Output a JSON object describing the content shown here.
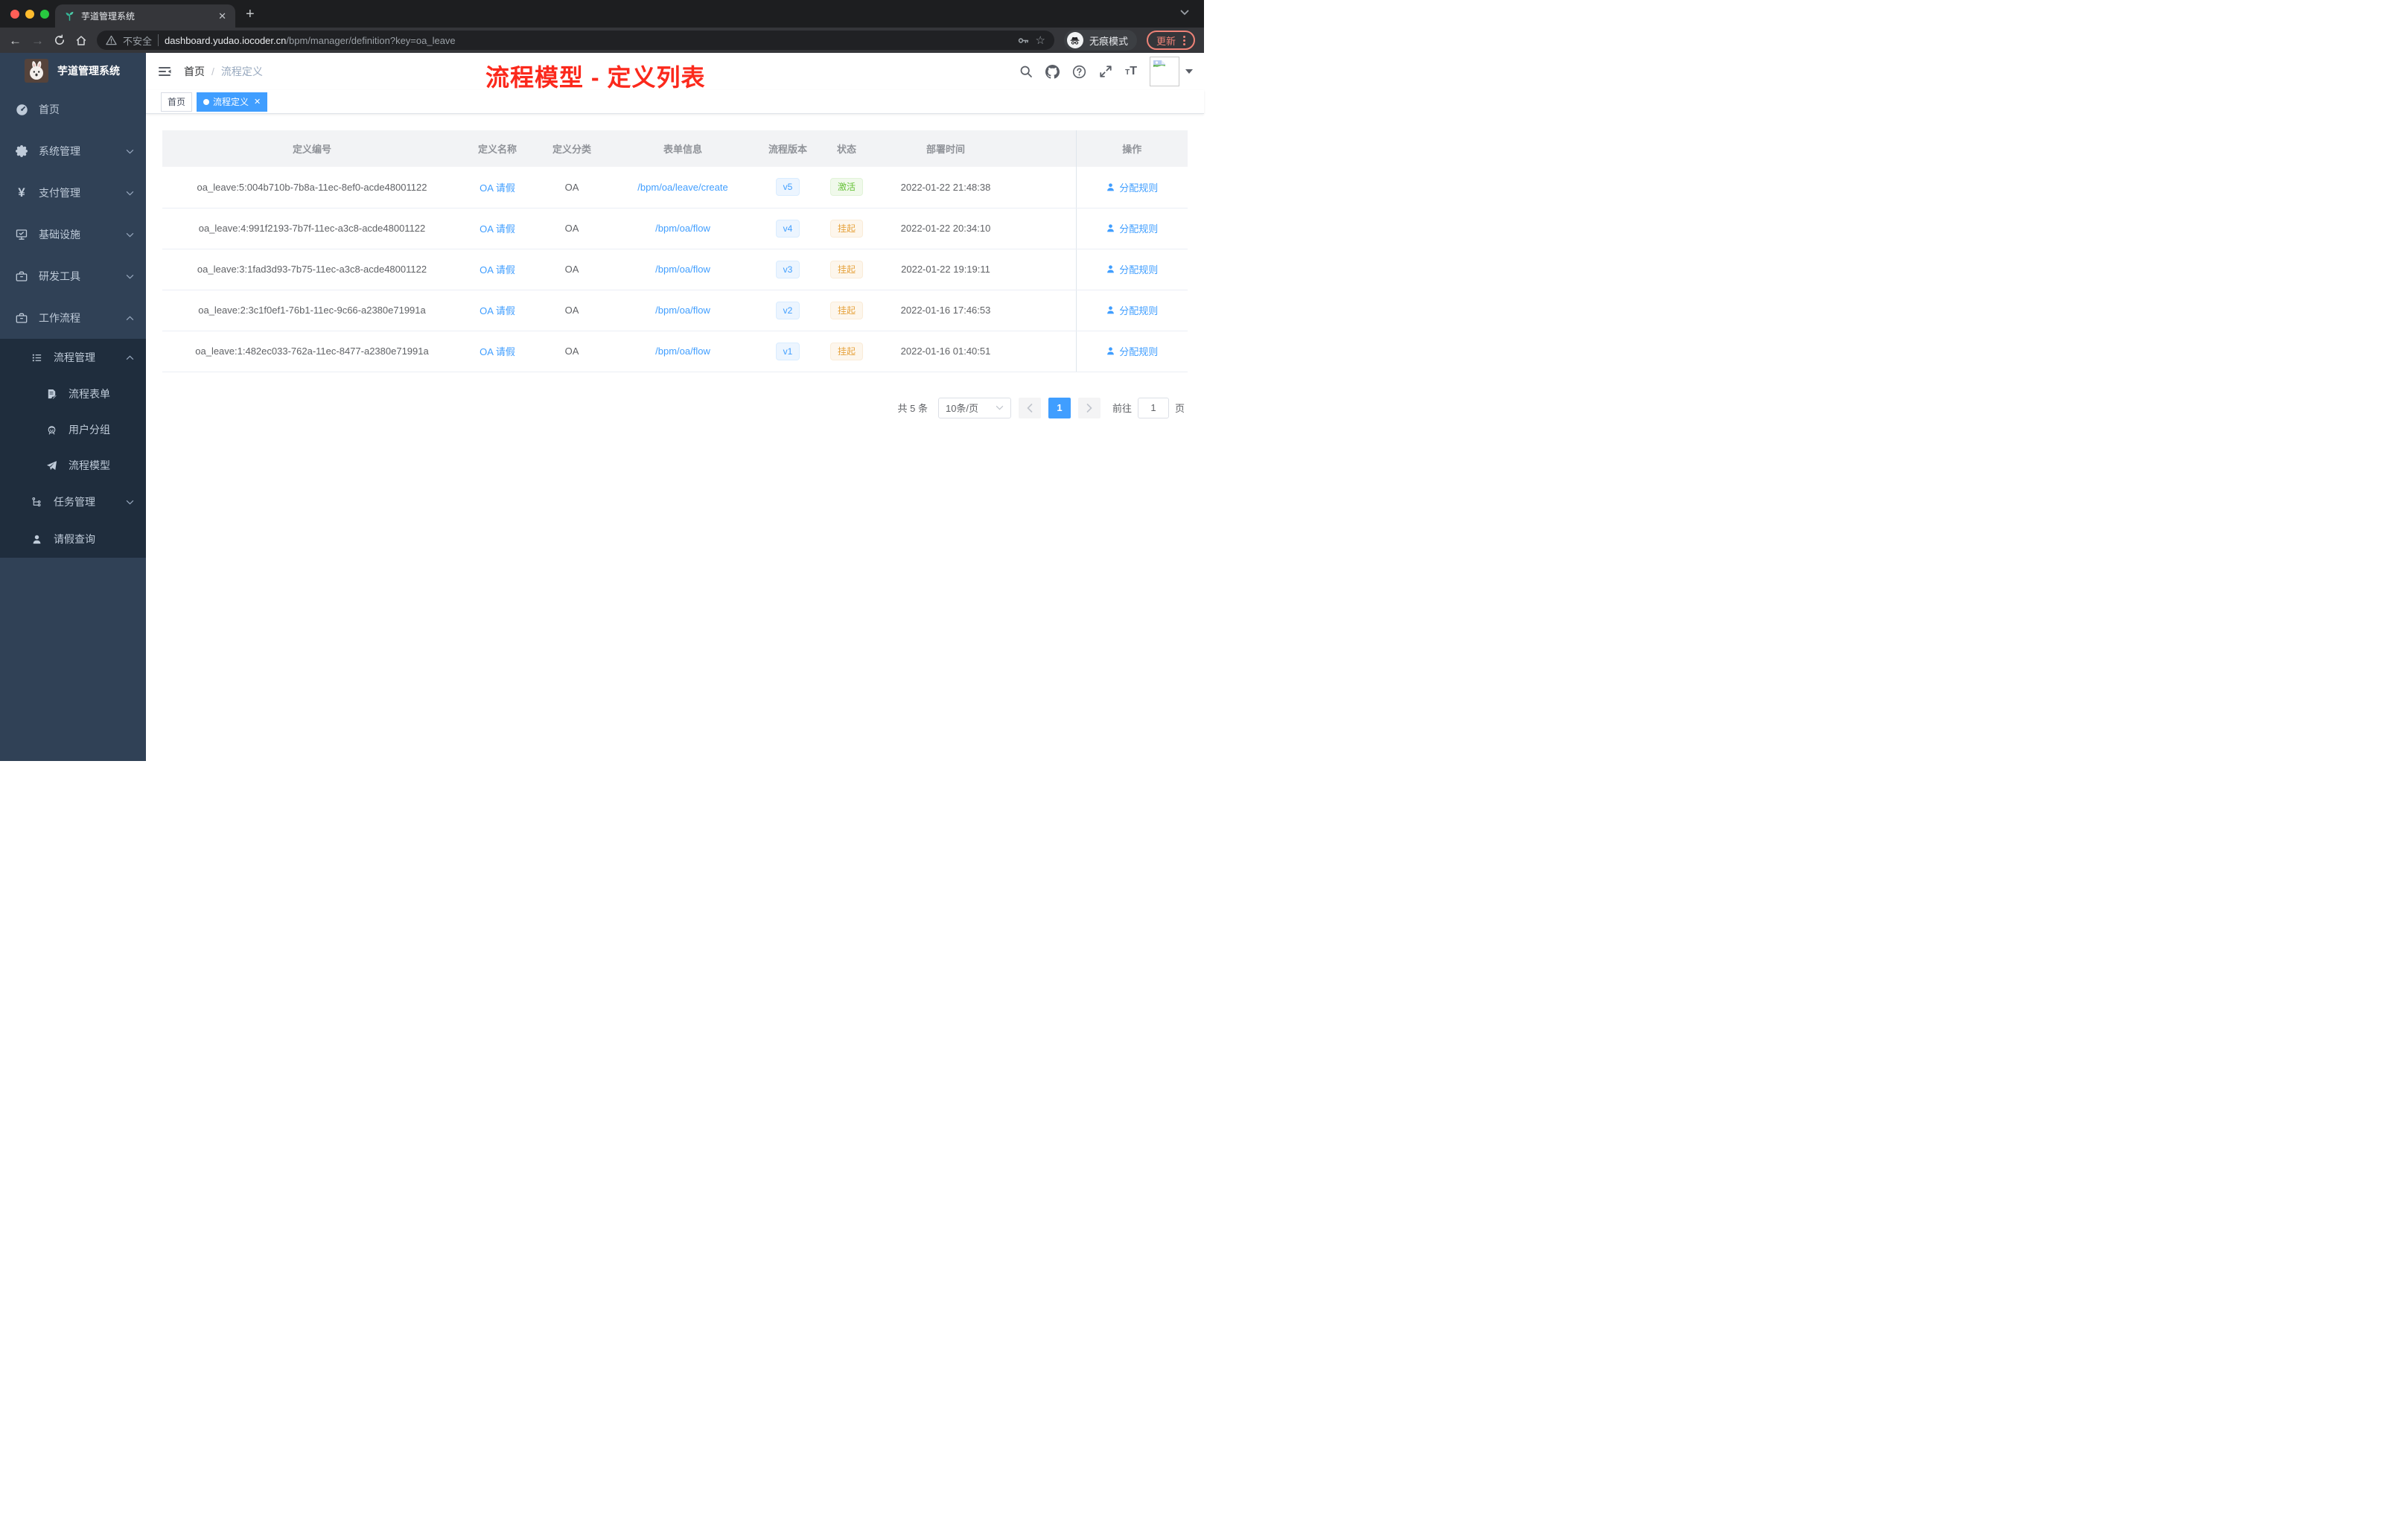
{
  "colors": {
    "accent": "#409eff",
    "sidebar_bg": "#304156",
    "submenu_bg": "#1f2d3d",
    "success": "#67c23a",
    "warning": "#e6a23c",
    "annotation_red": "#fb291c",
    "update_salmon": "#ee8277"
  },
  "browser": {
    "tab_title": "芋道管理系统",
    "security_label": "不安全",
    "url_domain": "dashboard.yudao.iocoder.cn",
    "url_path": "/bpm/manager/definition?key=oa_leave",
    "incognito_label": "无痕模式",
    "update_label": "更新"
  },
  "sidebar": {
    "logo_title": "芋道管理系统",
    "items": [
      {
        "label": "首页"
      },
      {
        "label": "系统管理"
      },
      {
        "label": "支付管理"
      },
      {
        "label": "基础设施"
      },
      {
        "label": "研发工具"
      },
      {
        "label": "工作流程"
      }
    ],
    "workflow_submenu": {
      "process_group": {
        "label": "流程管理",
        "children": [
          {
            "label": "流程表单"
          },
          {
            "label": "用户分组"
          },
          {
            "label": "流程模型"
          }
        ]
      },
      "task_group": {
        "label": "任务管理"
      },
      "leave_item": {
        "label": "请假查询"
      }
    }
  },
  "navbar": {
    "breadcrumb": {
      "home": "首页",
      "separator": "/",
      "current": "流程定义"
    },
    "annotation": "流程模型 - 定义列表"
  },
  "tags": [
    {
      "label": "首页"
    },
    {
      "label": "流程定义"
    }
  ],
  "table": {
    "headers": [
      "定义编号",
      "定义名称",
      "定义分类",
      "表单信息",
      "流程版本",
      "状态",
      "部署时间",
      "操作"
    ],
    "op_label": "分配规则",
    "rows": [
      {
        "id": "oa_leave:5:004b710b-7b8a-11ec-8ef0-acde48001122",
        "name": "OA 请假",
        "category": "OA",
        "form": "/bpm/oa/leave/create",
        "version": "v5",
        "status": "激活",
        "time": "2022-01-22 21:48:38"
      },
      {
        "id": "oa_leave:4:991f2193-7b7f-11ec-a3c8-acde48001122",
        "name": "OA 请假",
        "category": "OA",
        "form": "/bpm/oa/flow",
        "version": "v4",
        "status": "挂起",
        "time": "2022-01-22 20:34:10"
      },
      {
        "id": "oa_leave:3:1fad3d93-7b75-11ec-a3c8-acde48001122",
        "name": "OA 请假",
        "category": "OA",
        "form": "/bpm/oa/flow",
        "version": "v3",
        "status": "挂起",
        "time": "2022-01-22 19:19:11"
      },
      {
        "id": "oa_leave:2:3c1f0ef1-76b1-11ec-9c66-a2380e71991a",
        "name": "OA 请假",
        "category": "OA",
        "form": "/bpm/oa/flow",
        "version": "v2",
        "status": "挂起",
        "time": "2022-01-16 17:46:53"
      },
      {
        "id": "oa_leave:1:482ec033-762a-11ec-8477-a2380e71991a",
        "name": "OA 请假",
        "category": "OA",
        "form": "/bpm/oa/flow",
        "version": "v1",
        "status": "挂起",
        "time": "2022-01-16 01:40:51"
      }
    ]
  },
  "pagination": {
    "total_label": "共 5 条",
    "page_size_label": "10条/页",
    "current_page": "1",
    "goto_label": "前往",
    "goto_value": "1",
    "page_suffix": "页"
  }
}
